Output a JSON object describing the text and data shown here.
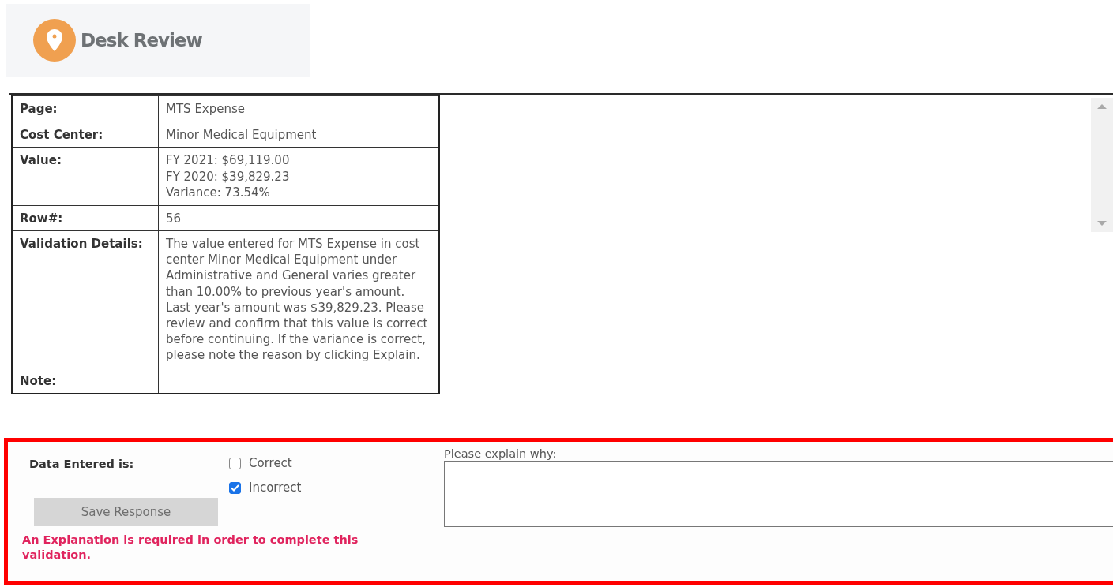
{
  "header": {
    "title": "Desk Review"
  },
  "details": [
    {
      "kind": "text",
      "label": "Page:",
      "value": "MTS Expense"
    },
    {
      "kind": "text",
      "label": "Cost Center:",
      "value": "Minor Medical Equipment"
    },
    {
      "kind": "lines",
      "label": "Value:",
      "lines": [
        "FY 2021: $69,119.00",
        "FY 2020: $39,829.23",
        "Variance: 73.54%"
      ]
    },
    {
      "kind": "text",
      "label": "Row#:",
      "value": "56"
    },
    {
      "kind": "text",
      "label": "Validation Details:",
      "value": "The value entered for MTS Expense in cost center Minor Medical Equipment under Administrative and General varies greater than 10.00% to previous year's amount. Last year's amount was $39,829.23. Please review and confirm that this value is correct before continuing. If the variance is correct, please note the reason by clicking Explain."
    },
    {
      "kind": "empty",
      "label": "Note:"
    }
  ],
  "response": {
    "label": "Data Entered is:",
    "options": [
      {
        "label": "Correct",
        "checked": false
      },
      {
        "label": "Incorrect",
        "checked": true
      }
    ],
    "save_button": {
      "label": "Save Response",
      "disabled": true
    },
    "error": "An Explanation is required in order to complete this validation.",
    "explanation": {
      "label": "Please explain why:"
    }
  }
}
